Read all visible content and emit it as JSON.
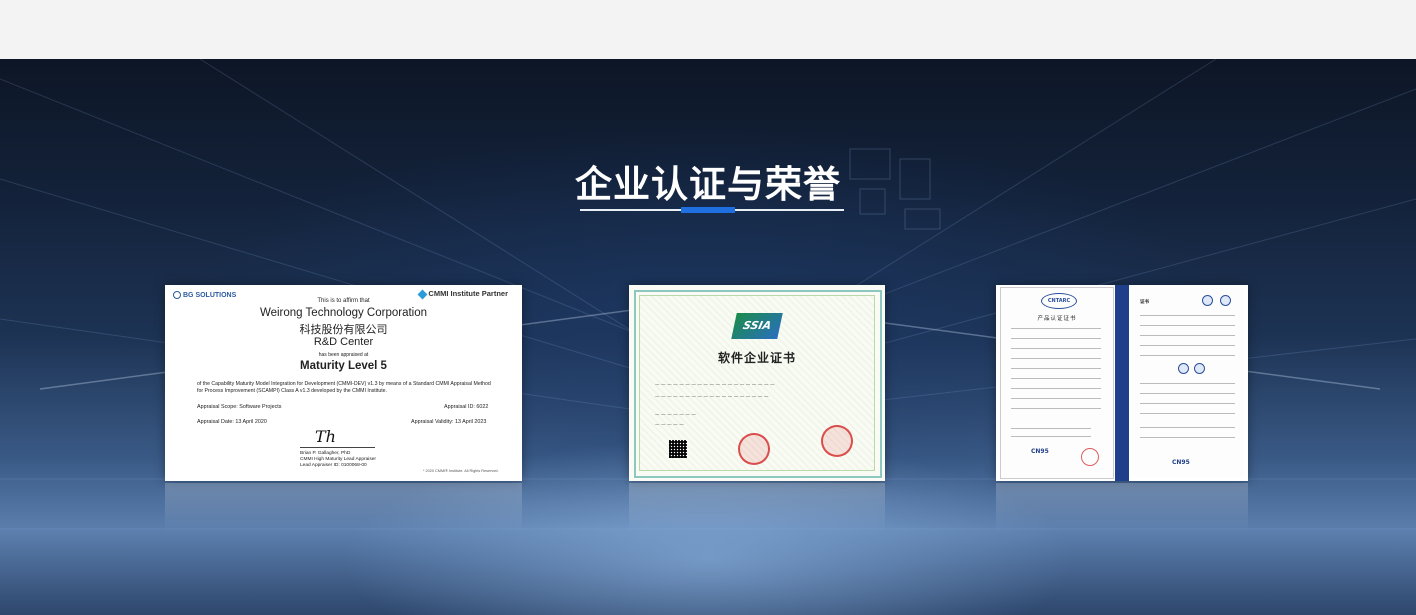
{
  "section": {
    "title": "企业认证与荣誉"
  },
  "certificates": {
    "cmmi": {
      "brand": "BG SOLUTIONS",
      "partner": "CMMI Institute Partner",
      "affirm": "This is to affirm that",
      "company_en": "Weirong Technology Corporation",
      "company_cn": "科技股份有限公司",
      "unit": "R&D Center",
      "appraised": "has been appraised at",
      "level": "Maturity Level 5",
      "body": "of the Capability Maturity Model Integration for Development (CMMI-DEV) v1.3 by means of a Standard CMMI Appraisal Method for Process Improvement (SCAMPI) Class A v1.3 developed by the CMMI Institute.",
      "scope": "Appraisal Scope:  Software Projects",
      "appraisal_id": "Appraisal ID: 6022",
      "date": "Appraisal Date: 13 April 2020",
      "validity": "Appraisal Validity: 13 April 2023",
      "signer_name": "Brian P. Gallagher, PhD",
      "signer_role": "CMMI High Maturity Lead Appraiser",
      "signer_id": "Lead Appraiser ID:  0100068-00",
      "footnote": "* 2020 CMMI® Institute. All Rights Reserved."
    },
    "ssia": {
      "logo": "SSIA",
      "title": "软件企业证书"
    },
    "cn95": {
      "logo": "CNTARC",
      "title": "产品认证证书",
      "tag_left": "CN95",
      "tag_right": "CN95",
      "right_title": "证书"
    }
  }
}
